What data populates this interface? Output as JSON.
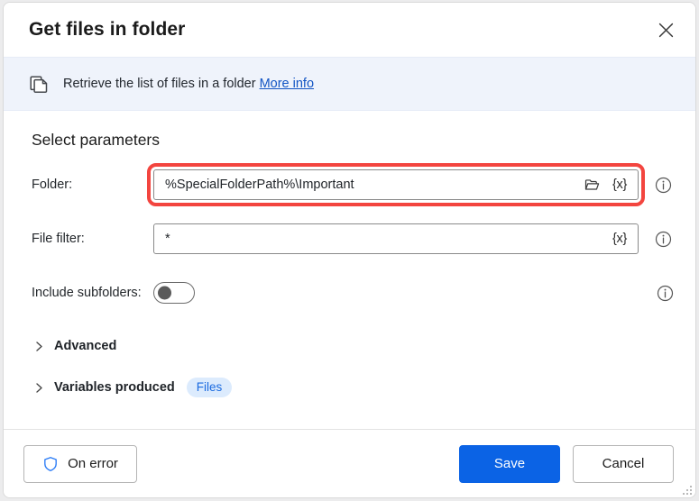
{
  "window": {
    "title": "Get files in folder",
    "close_icon": "close-icon"
  },
  "banner": {
    "icon": "copy-files-icon",
    "text": "Retrieve the list of files in a folder",
    "link_label": "More info"
  },
  "main": {
    "section_title": "Select parameters",
    "fields": [
      {
        "label": "Folder:",
        "value": "%SpecialFolderPath%\\Important",
        "placeholder": "",
        "folder_icon": "open-folder-icon",
        "variable_icon": "{x}",
        "info_icon": "info-icon",
        "highlighted": true
      },
      {
        "label": "File filter:",
        "value": "*",
        "placeholder": "",
        "variable_icon": "{x}",
        "info_icon": "info-icon",
        "highlighted": false
      }
    ],
    "toggle": {
      "label": "Include subfolders:",
      "state": "off",
      "info_icon": "info-icon"
    },
    "expanders": [
      {
        "label": "Advanced",
        "chevron": "chevron-right-icon",
        "pill": null
      },
      {
        "label": "Variables produced",
        "chevron": "chevron-right-icon",
        "pill": "Files"
      }
    ]
  },
  "footer": {
    "on_error_label": "On error",
    "on_error_icon": "shield-icon",
    "save_label": "Save",
    "cancel_label": "Cancel",
    "resize_grip": "resize-grip-icon"
  },
  "colors": {
    "accent_blue": "#0b63e5",
    "link_blue": "#1355c4",
    "banner_bg": "#eff3fb",
    "pill_bg": "#dcebfd",
    "pill_text": "#1a6ae0",
    "highlight_red": "#f3453f",
    "shield_blue": "#2b7cf6"
  }
}
